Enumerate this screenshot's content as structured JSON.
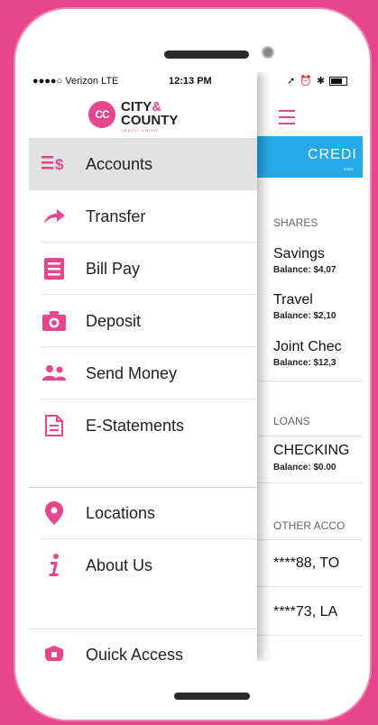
{
  "status_bar": {
    "carrier": "●●●●○ Verizon  LTE",
    "time": "12:13 PM",
    "icons": "➚ ⏰ ✱"
  },
  "brand": {
    "logo_mark": "CC",
    "line1": "CITY",
    "amp": "&",
    "line2": "COUNTY",
    "tagline": "CREDIT UNION",
    "accent_color": "#e8458f",
    "banner_color": "#26a9e8"
  },
  "menu": {
    "items": [
      {
        "label": "Accounts",
        "icon": "accounts-icon"
      },
      {
        "label": "Transfer",
        "icon": "transfer-icon"
      },
      {
        "label": "Bill Pay",
        "icon": "bill-pay-icon"
      },
      {
        "label": "Deposit",
        "icon": "camera-icon"
      },
      {
        "label": "Send Money",
        "icon": "people-icon"
      },
      {
        "label": "E-Statements",
        "icon": "document-icon"
      },
      {
        "label": "Locations",
        "icon": "location-pin-icon"
      },
      {
        "label": "About Us",
        "icon": "info-icon"
      },
      {
        "label": "Quick Access",
        "icon": "quick-access-icon"
      }
    ]
  },
  "main": {
    "banner_title": "CREDI",
    "banner_sub": "ENDE",
    "shares_header": "SHARES",
    "shares": [
      {
        "name": "Savings",
        "balance": "Balance: $4,07"
      },
      {
        "name": "Travel",
        "balance": "Balance: $2,10"
      },
      {
        "name": "Joint Chec",
        "balance": "Balance: $12,3"
      }
    ],
    "loans_header": "LOANS",
    "loans": [
      {
        "name": "CHECKING",
        "balance": "Balance: $0.00"
      }
    ],
    "other_header": "OTHER ACCO",
    "other": [
      {
        "name": "****88, TO"
      },
      {
        "name": "****73, LA"
      }
    ]
  }
}
